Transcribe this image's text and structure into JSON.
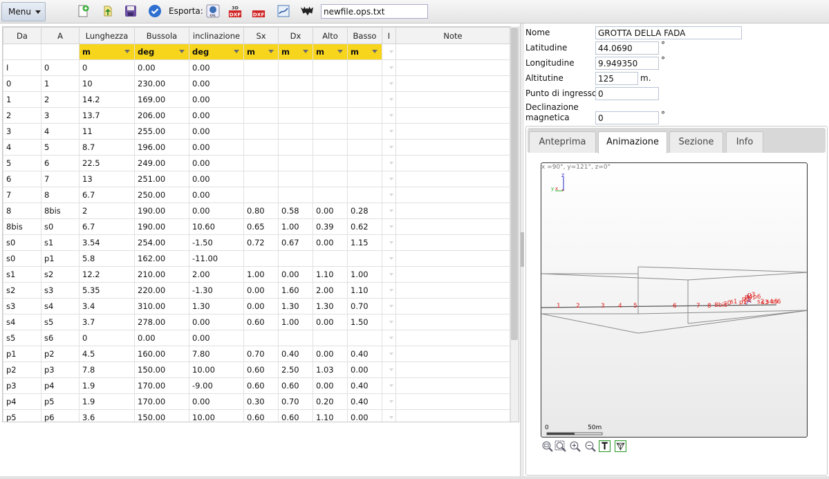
{
  "toolbar": {
    "menu_label": "Menu",
    "export_label": "Esporta:",
    "filename": "newfile.ops.txt",
    "icons": [
      "new-file-icon",
      "open-file-icon",
      "save-icon",
      "check-icon",
      "export-kml-icon",
      "export-3d-dxf-icon",
      "export-dxf-icon",
      "export-map-icon",
      "bat-logo-icon"
    ],
    "icon_text": {
      "kml": "KML",
      "sd": "3D",
      "dxf": "DXF"
    }
  },
  "table": {
    "headers": [
      "Da",
      "A",
      "Lunghezza",
      "Bussola",
      "inclinazione",
      "Sx",
      "Dx",
      "Alto",
      "Basso",
      "I",
      "Note"
    ],
    "units": [
      "",
      "",
      "m",
      "deg",
      "deg",
      "m",
      "m",
      "m",
      "m",
      "",
      ""
    ],
    "rows": [
      [
        "I",
        "0",
        "0",
        "0.00",
        "0.00",
        "",
        "",
        "",
        "",
        "",
        ""
      ],
      [
        "0",
        "1",
        "10",
        "230.00",
        "0.00",
        "",
        "",
        "",
        "",
        "",
        ""
      ],
      [
        "1",
        "2",
        "14.2",
        "169.00",
        "0.00",
        "",
        "",
        "",
        "",
        "",
        ""
      ],
      [
        "2",
        "3",
        "13.7",
        "206.00",
        "0.00",
        "",
        "",
        "",
        "",
        "",
        ""
      ],
      [
        "3",
        "4",
        "11",
        "255.00",
        "0.00",
        "",
        "",
        "",
        "",
        "",
        ""
      ],
      [
        "4",
        "5",
        "8.7",
        "196.00",
        "0.00",
        "",
        "",
        "",
        "",
        "",
        ""
      ],
      [
        "5",
        "6",
        "22.5",
        "249.00",
        "0.00",
        "",
        "",
        "",
        "",
        "",
        ""
      ],
      [
        "6",
        "7",
        "13",
        "251.00",
        "0.00",
        "",
        "",
        "",
        "",
        "",
        ""
      ],
      [
        "7",
        "8",
        "6.7",
        "250.00",
        "0.00",
        "",
        "",
        "",
        "",
        "",
        ""
      ],
      [
        "8",
        "8bis",
        "2",
        "190.00",
        "0.00",
        "0.80",
        "0.58",
        "0.00",
        "0.28",
        "",
        ""
      ],
      [
        "8bis",
        "s0",
        "6.7",
        "190.00",
        "10.60",
        "0.65",
        "1.00",
        "0.39",
        "0.62",
        "",
        ""
      ],
      [
        "s0",
        "s1",
        "3.54",
        "254.00",
        "-1.50",
        "0.72",
        "0.67",
        "0.00",
        "1.15",
        "",
        ""
      ],
      [
        "s0",
        "p1",
        "5.8",
        "162.00",
        "-11.00",
        "",
        "",
        "",
        "",
        "",
        ""
      ],
      [
        "s1",
        "s2",
        "12.2",
        "210.00",
        "2.00",
        "1.00",
        "0.00",
        "1.10",
        "1.00",
        "",
        ""
      ],
      [
        "s2",
        "s3",
        "5.35",
        "220.00",
        "-1.30",
        "0.00",
        "1.60",
        "2.00",
        "1.10",
        "",
        ""
      ],
      [
        "s3",
        "s4",
        "3.4",
        "310.00",
        "1.30",
        "0.00",
        "1.30",
        "1.30",
        "0.70",
        "",
        ""
      ],
      [
        "s4",
        "s5",
        "3.7",
        "278.00",
        "0.00",
        "0.60",
        "1.00",
        "0.00",
        "1.50",
        "",
        ""
      ],
      [
        "s5",
        "s6",
        "0",
        "0.00",
        "0.00",
        "",
        "",
        "",
        "",
        "",
        ""
      ],
      [
        "p1",
        "p2",
        "4.5",
        "160.00",
        "7.80",
        "0.70",
        "0.40",
        "0.00",
        "0.40",
        "",
        ""
      ],
      [
        "p2",
        "p3",
        "7.8",
        "150.00",
        "10.00",
        "0.60",
        "2.50",
        "1.03",
        "0.00",
        "",
        ""
      ],
      [
        "p3",
        "p4",
        "1.9",
        "170.00",
        "-9.00",
        "0.60",
        "0.60",
        "0.00",
        "0.40",
        "",
        ""
      ],
      [
        "p4",
        "p5",
        "1.9",
        "170.00",
        "0.00",
        "0.30",
        "0.70",
        "0.20",
        "0.40",
        "",
        ""
      ],
      [
        "p5",
        "p6",
        "3.6",
        "150.00",
        "10.00",
        "0.60",
        "0.60",
        "1.10",
        "0.00",
        "",
        ""
      ]
    ]
  },
  "form": {
    "nome_label": "Nome",
    "nome_value": "GROTTA DELLA FADA",
    "lat_label": "Latitudine",
    "lat_value": "44.0690",
    "lon_label": "Longitudine",
    "lon_value": "9.949350",
    "alt_label": "Altitutine",
    "alt_value": "125",
    "alt_unit": "m.",
    "ingresso_label": "Punto di ingresso",
    "ingresso_value": "0",
    "decl_label_1": "Declinazione",
    "decl_label_2": "magnetica",
    "decl_value": "0",
    "deg_symbol": "°"
  },
  "tabs": [
    {
      "label": "Anteprima",
      "active": false
    },
    {
      "label": "Animazione",
      "active": true
    },
    {
      "label": "Sezione",
      "active": false
    },
    {
      "label": "Info",
      "active": false
    }
  ],
  "viewer": {
    "view_info": "x =90°, y=121°, z=0°",
    "axis_z": "z",
    "axis_y": "y",
    "axis_x": "x",
    "station_labels": [
      "1",
      "2",
      "3",
      "4",
      "5",
      "6",
      "7",
      "8",
      "8bis",
      "s0",
      "s1",
      "s2",
      "s3",
      "s4",
      "s5",
      "s6",
      "p1",
      "p2",
      "p3",
      "p4",
      "p5",
      "p6"
    ],
    "scale_start": "0",
    "scale_end": "50m",
    "tool_icons": [
      "zoom-fit-icon",
      "zoom-window-icon",
      "zoom-in-icon",
      "zoom-out-icon",
      "toggle-labels-icon",
      "toggle-3d-icon"
    ],
    "label_color": "#e0201c",
    "axis_colors": {
      "x": "#d22",
      "y": "#2a2",
      "z": "#22c"
    }
  }
}
